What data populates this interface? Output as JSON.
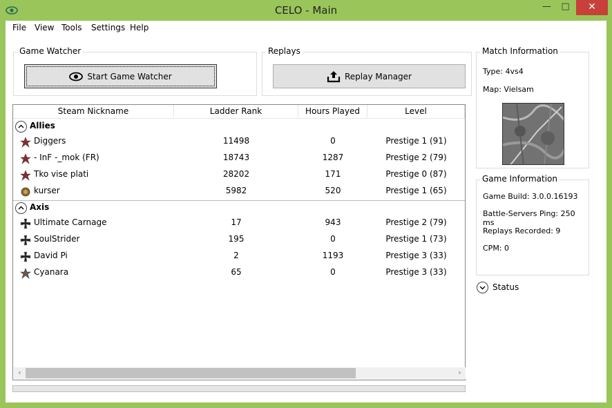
{
  "window": {
    "title": "CELO - Main"
  },
  "menu": [
    "File",
    "View",
    "Tools",
    "Settings",
    "Help"
  ],
  "game_watcher": {
    "title": "Game Watcher",
    "button": "Start Game Watcher"
  },
  "replays": {
    "title": "Replays",
    "button": "Replay Manager"
  },
  "match_info": {
    "title": "Match Information",
    "type": "Type: 4vs4",
    "map": "Map: Vielsam"
  },
  "game_info": {
    "title": "Game Information",
    "build": "Game Build: 3.0.0.16193",
    "ping": "Battle-Servers Ping: 250 ms",
    "replays": "Replays Recorded: 9",
    "cpm": "CPM: 0"
  },
  "status_label": "Status",
  "table": {
    "columns": [
      "Steam Nickname",
      "Ladder Rank",
      "Hours Played",
      "Level"
    ],
    "groups": [
      {
        "name": "Allies",
        "players": [
          {
            "name": "Diggers",
            "rank": "11498",
            "hours": "0",
            "level": "Prestige 1 (91)",
            "faction": "soviet"
          },
          {
            "name": "- InF -_mok (FR)",
            "rank": "18743",
            "hours": "1287",
            "level": "Prestige 2 (79)",
            "faction": "soviet"
          },
          {
            "name": "Tko vise plati",
            "rank": "28202",
            "hours": "171",
            "level": "Prestige 0 (87)",
            "faction": "soviet"
          },
          {
            "name": "kurser",
            "rank": "5982",
            "hours": "520",
            "level": "Prestige 1 (65)",
            "faction": "british"
          }
        ]
      },
      {
        "name": "Axis",
        "players": [
          {
            "name": "Ultimate Carnage",
            "rank": "17",
            "hours": "943",
            "level": "Prestige 2 (79)",
            "faction": "wehrmacht"
          },
          {
            "name": "SoulStrider",
            "rank": "195",
            "hours": "0",
            "level": "Prestige 1 (73)",
            "faction": "wehrmacht"
          },
          {
            "name": "David Pi",
            "rank": "2",
            "hours": "1193",
            "level": "Prestige 3 (33)",
            "faction": "wehrmacht"
          },
          {
            "name": "Cyanara",
            "rank": "65",
            "hours": "0",
            "level": "Prestige 3 (33)",
            "faction": "okw"
          }
        ]
      }
    ]
  },
  "colors": {
    "accent": "#9ac55a",
    "close_button": "#c7403a"
  }
}
